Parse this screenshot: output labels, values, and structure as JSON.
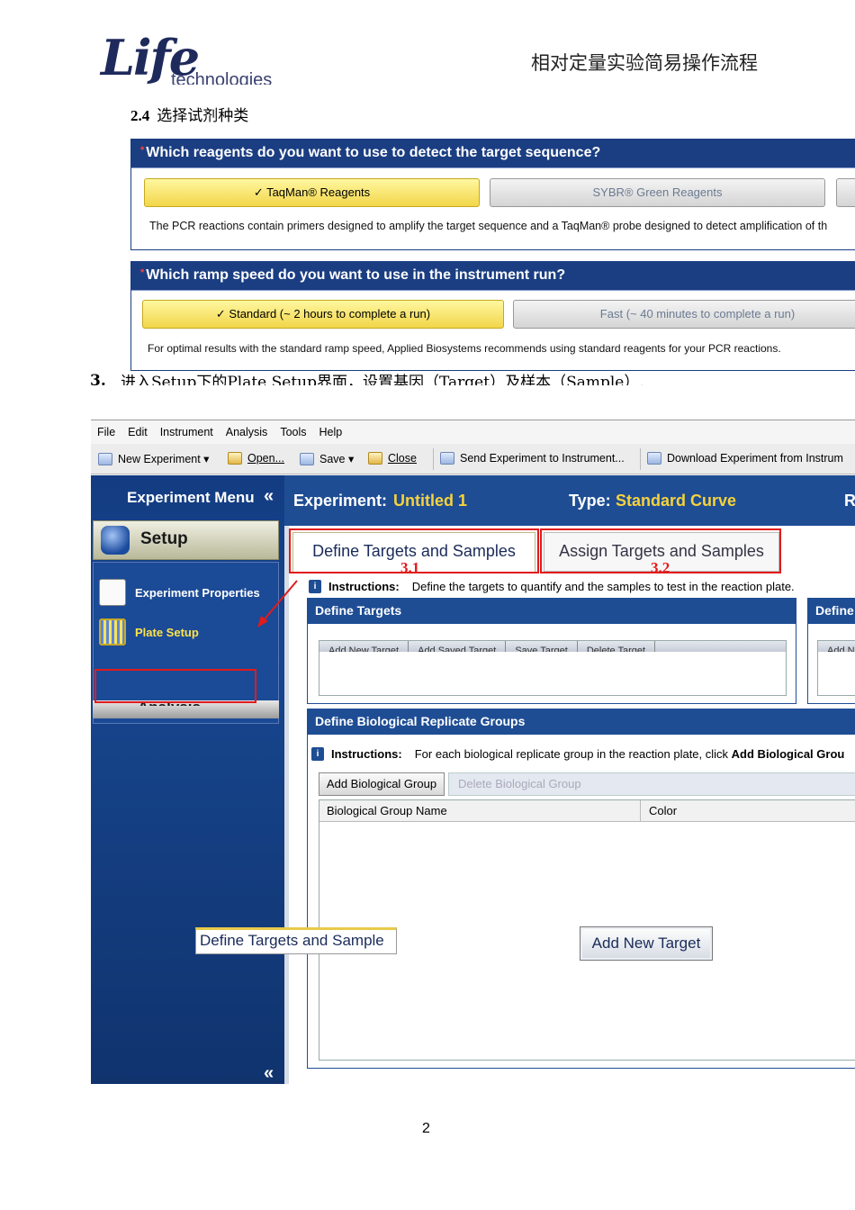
{
  "header": {
    "logo_main": "Life",
    "logo_sub": "technologies",
    "doc_title": "相对定量实验简易操作流程"
  },
  "section_24": {
    "number": "2.4",
    "title": "选择试剂种类"
  },
  "reagent_panel": {
    "question": "Which reagents do you want to use to detect the target sequence?",
    "options": [
      {
        "label": "✓ TaqMan® Reagents",
        "selected": true
      },
      {
        "label": "SYBR® Green Reagents",
        "selected": false
      }
    ],
    "description": "The PCR reactions contain primers designed to amplify the target sequence and a TaqMan® probe designed to detect amplification of th"
  },
  "ramp_panel": {
    "question": "Which ramp speed do you want to use in the instrument run?",
    "options": [
      {
        "label": "✓ Standard (~ 2 hours to complete a run)",
        "selected": true
      },
      {
        "label": "Fast (~ 40 minutes to complete a run)",
        "selected": false
      }
    ],
    "description": "For optimal results with the standard ramp speed, Applied Biosystems recommends using standard reagents for your PCR reactions."
  },
  "step3": {
    "number": "3.",
    "text": "进入Setup下的Plate Setup界面，设置基因（Target）及样本（Sample）."
  },
  "app": {
    "menu": [
      "File",
      "Edit",
      "Instrument",
      "Analysis",
      "Tools",
      "Help"
    ],
    "toolbar": {
      "new_experiment": "New Experiment",
      "open": "Open...",
      "save": "Save",
      "close": "Close",
      "send": "Send Experiment to Instrument...",
      "download": "Download Experiment from Instrum"
    },
    "sidebar": {
      "title": "Experiment Menu",
      "collapse": "«",
      "setup": "Setup",
      "experiment_properties": "Experiment Properties",
      "plate_setup": "Plate Setup",
      "analysis": "Analysis"
    },
    "experiment_bar": {
      "experiment_label": "Experiment:",
      "experiment_name": "Untitled 1",
      "type_label": "Type:",
      "type_value": "Standard Curve",
      "cut": "R"
    },
    "tabs": [
      {
        "label": "Define Targets and Samples",
        "marker": "3.1"
      },
      {
        "label": "Assign Targets and Samples",
        "marker": "3.2"
      }
    ],
    "instructions": {
      "label": "Instructions:",
      "text": "Define the targets to quantify and the samples to test in the reaction plate."
    },
    "define_targets": {
      "title": "Define Targets",
      "buttons": [
        "Add New Target",
        "Add Saved Target",
        "Save Target",
        "Delete Target"
      ]
    },
    "define_samples": {
      "title": "Define",
      "button": "Add N"
    },
    "bio_groups": {
      "title": "Define Biological Replicate Groups",
      "instructions_label": "Instructions:",
      "instructions_text": "For each biological replicate group in the reaction plate, click",
      "instructions_bold": "Add Biological Grou",
      "add_button": "Add Biological Group",
      "delete_button": "Delete Biological Group",
      "columns": [
        "Biological Group Name",
        "Color"
      ]
    },
    "callouts": {
      "tab_zoom": "Define Targets and Sample",
      "button_zoom": "Add New Target"
    }
  },
  "page_number": "2",
  "colors": {
    "panel_blue": "#1b3e82",
    "selected_yellow": "#f2d64a",
    "highlight_red": "#e21b1b",
    "accent_yellow": "#f7d23c"
  }
}
